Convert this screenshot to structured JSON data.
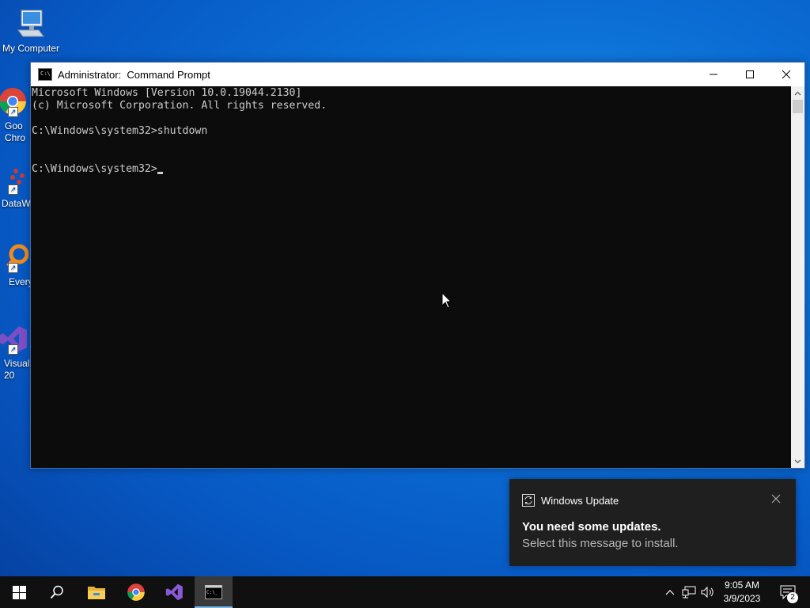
{
  "desktop": {
    "icons": [
      {
        "label": "My Computer"
      },
      {
        "label": "Goo\nChro"
      },
      {
        "label": "DataW"
      },
      {
        "label": "Every"
      },
      {
        "label": "Visual\n20"
      }
    ]
  },
  "window": {
    "title": "Administrator:  Command Prompt",
    "console_lines": [
      "Microsoft Windows [Version 10.0.19044.2130]",
      "(c) Microsoft Corporation. All rights reserved.",
      "",
      "C:\\Windows\\system32>shutdown",
      "",
      "",
      "C:\\Windows\\system32>"
    ]
  },
  "toast": {
    "app": "Windows Update",
    "heading": "You need some updates.",
    "body": "Select this message to install."
  },
  "taskbar": {
    "time": "9:05 AM",
    "date": "3/9/2023",
    "notification_count": "2",
    "pinned": [
      "start-icon",
      "search-icon",
      "file-explorer-icon",
      "chrome-icon",
      "visual-studio-icon",
      "command-prompt-icon"
    ]
  },
  "colors": {
    "console_bg": "#0c0c0c",
    "console_fg": "#cccccc",
    "taskbar_bg": "#101010",
    "accent": "#76b9ed"
  }
}
